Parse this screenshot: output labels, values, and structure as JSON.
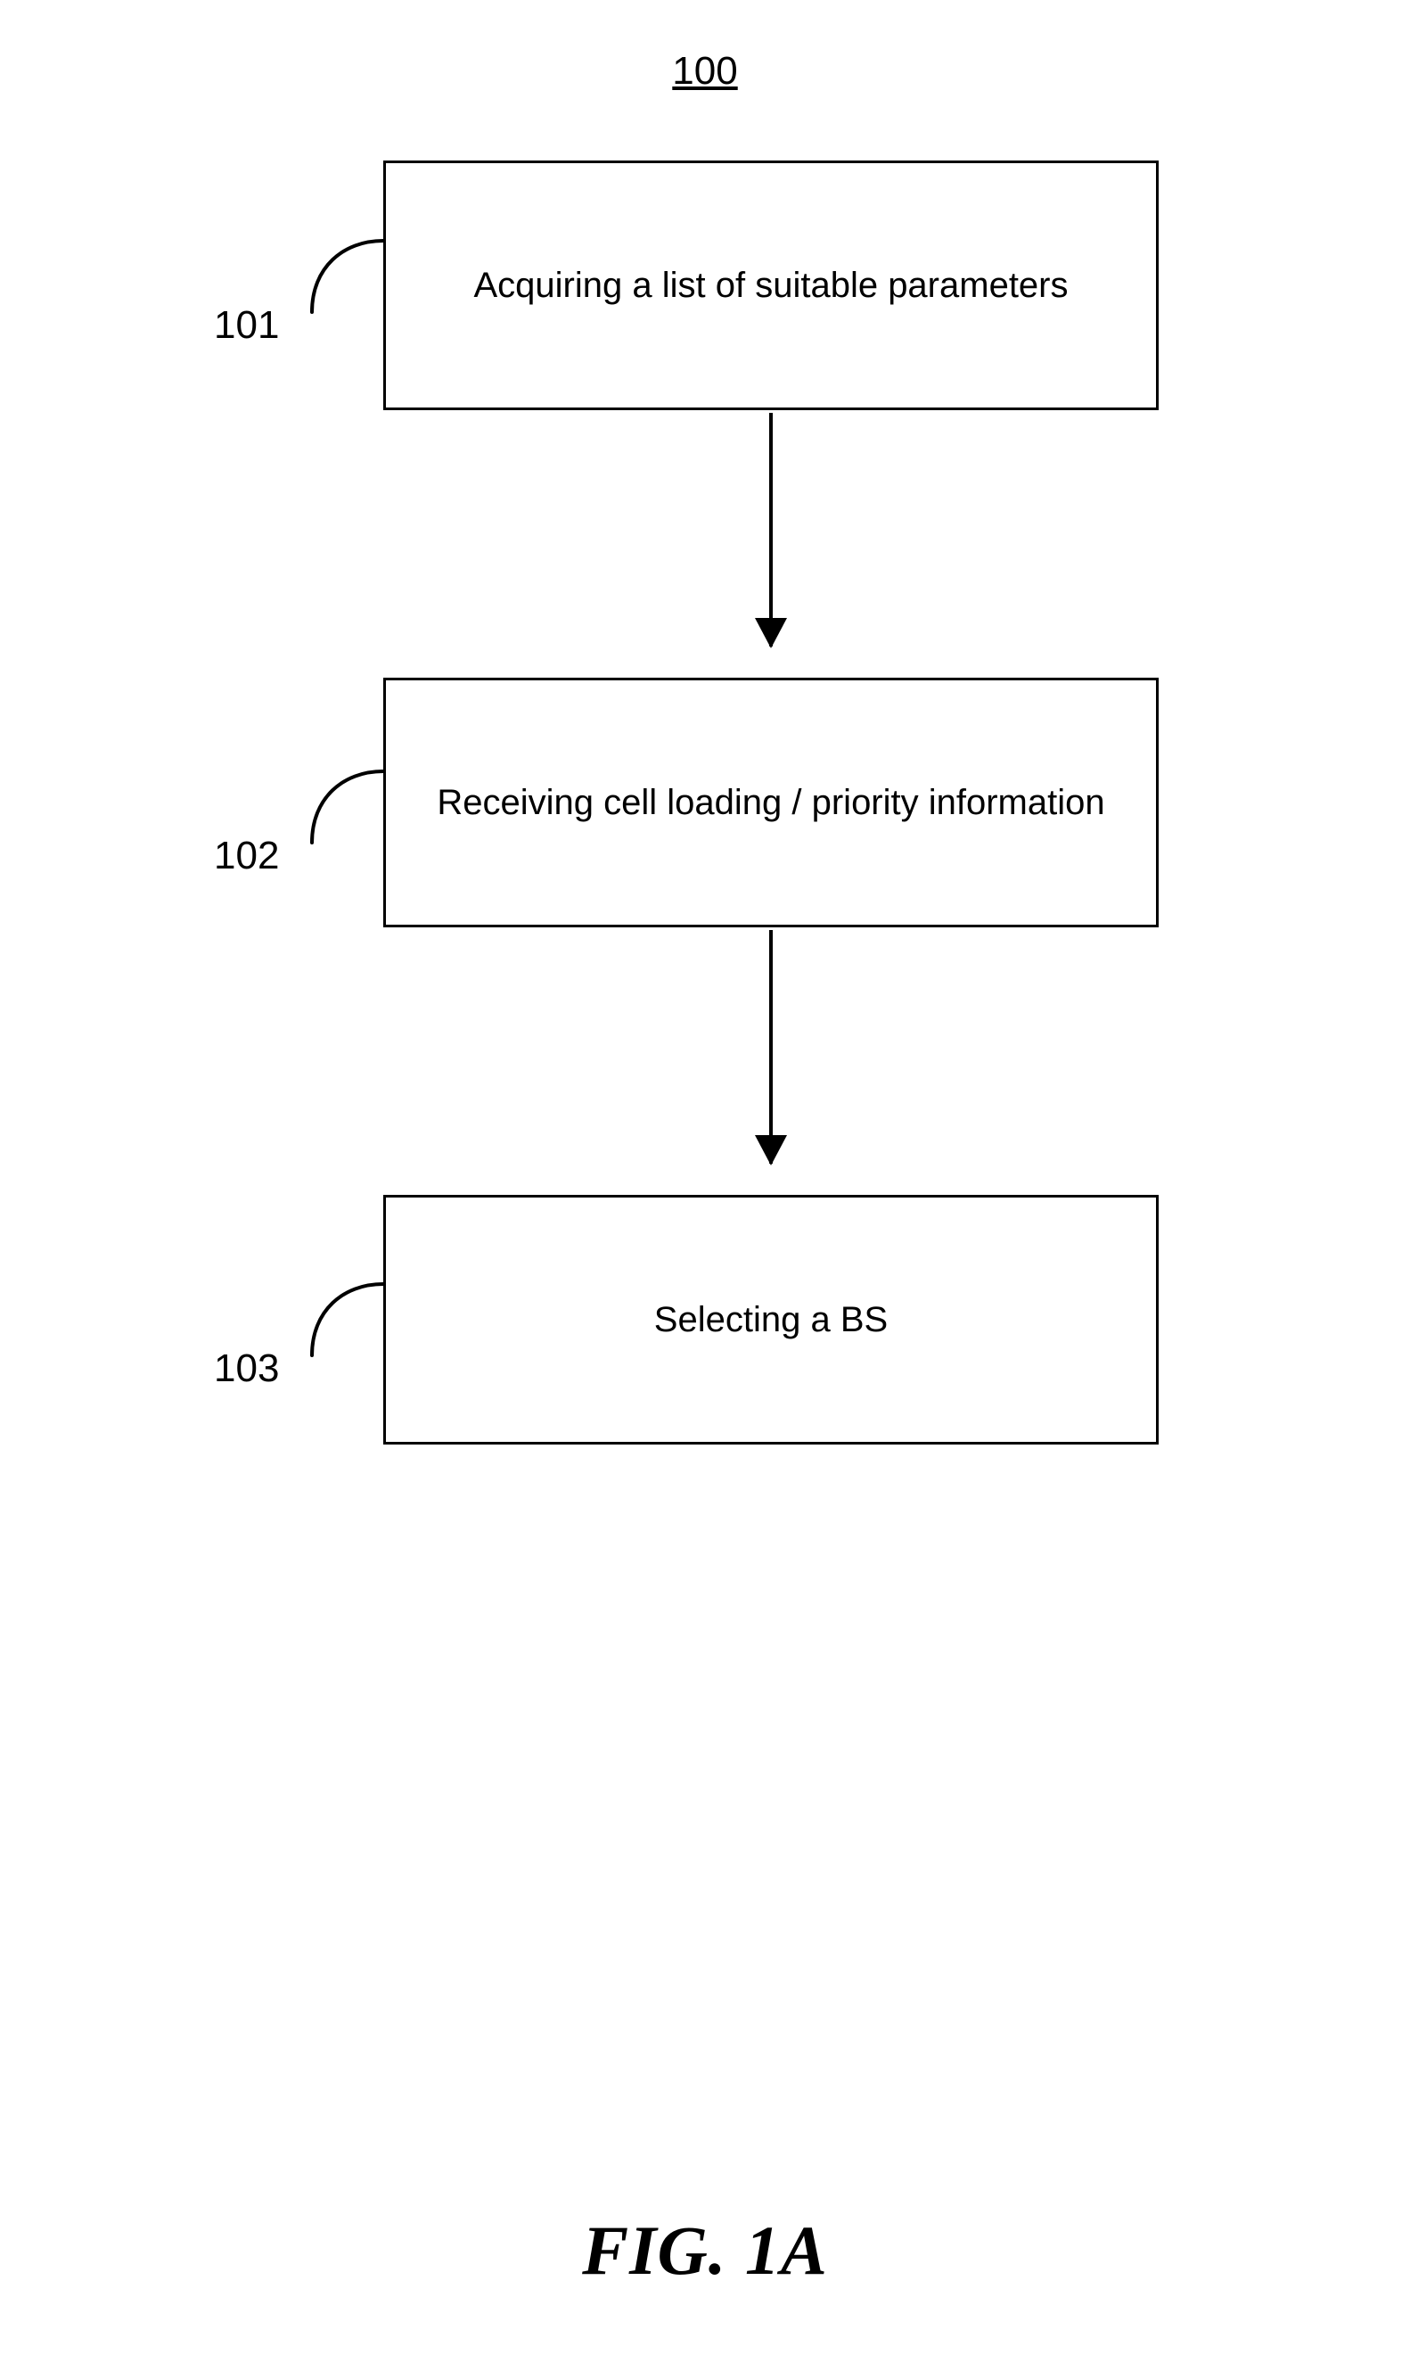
{
  "title": "100",
  "steps": [
    {
      "ref": "101",
      "text": "Acquiring a list of suitable parameters"
    },
    {
      "ref": "102",
      "text": "Receiving cell loading / priority information"
    },
    {
      "ref": "103",
      "text": "Selecting a BS"
    }
  ],
  "figure_caption": "FIG. 1A",
  "chart_data": {
    "type": "flowchart",
    "title_ref": "100",
    "nodes": [
      {
        "id": "101",
        "label": "Acquiring a list of suitable parameters",
        "shape": "rect"
      },
      {
        "id": "102",
        "label": "Receiving cell loading / priority information",
        "shape": "rect"
      },
      {
        "id": "103",
        "label": "Selecting a BS",
        "shape": "rect"
      }
    ],
    "edges": [
      {
        "from": "101",
        "to": "102"
      },
      {
        "from": "102",
        "to": "103"
      }
    ],
    "caption": "FIG. 1A"
  }
}
